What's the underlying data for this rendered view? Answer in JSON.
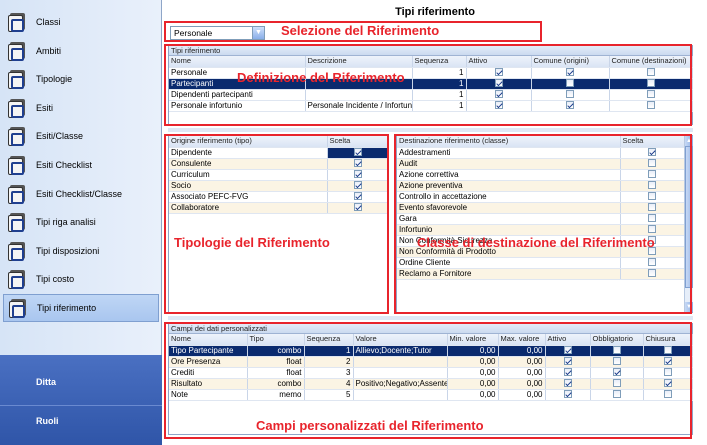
{
  "sidebar": {
    "items": [
      {
        "label": "Classi",
        "icon": "folder-icon"
      },
      {
        "label": "Ambiti",
        "icon": "folder-icon"
      },
      {
        "label": "Tipologie",
        "icon": "folder-icon"
      },
      {
        "label": "Esiti",
        "icon": "folder-icon"
      },
      {
        "label": "Esiti/Classe",
        "icon": "folder-icon"
      },
      {
        "label": "Esiti Checklist",
        "icon": "folder-icon"
      },
      {
        "label": "Esiti Checklist/Classe",
        "icon": "folder-icon"
      },
      {
        "label": "Tipi riga analisi",
        "icon": "folder-icon"
      },
      {
        "label": "Tipi disposizioni",
        "icon": "folder-icon"
      },
      {
        "label": "Tipi costo",
        "icon": "folder-icon"
      },
      {
        "label": "Tipi riferimento",
        "icon": "folder-gear-icon",
        "active": true
      }
    ],
    "bottom": [
      {
        "label": "Ditta"
      },
      {
        "label": "Ruoli"
      }
    ]
  },
  "main": {
    "title": "Tipi riferimento",
    "combo_value": "Personale"
  },
  "annotations": {
    "selezione": "Selezione del Riferimento",
    "definizione": "Definizione del Riferimento",
    "tipologie": "Tipologie del Riferimento",
    "classe": "Classe di destinazione del Riferimento",
    "campi": "Campi personalizzati del Riferimento"
  },
  "ref_table": {
    "title": "Tipi riferimento",
    "headers": [
      "Nome",
      "Descrizione",
      "Sequenza",
      "Attivo",
      "Comune (origini)",
      "Comune (destinazioni)"
    ],
    "rows": [
      {
        "nome": "Personale",
        "descrizione": "",
        "sequenza": "1",
        "attivo": true,
        "origini": true,
        "destinazioni": false
      },
      {
        "nome": "Partecipanti",
        "descrizione": "",
        "sequenza": "1",
        "attivo": true,
        "origini": false,
        "destinazioni": false
      },
      {
        "nome": "Dipendenti partecipanti",
        "descrizione": "",
        "sequenza": "1",
        "attivo": true,
        "origini": false,
        "destinazioni": false
      },
      {
        "nome": "Personale infortunio",
        "descrizione": "Personale Incidente / Infortun",
        "sequenza": "1",
        "attivo": true,
        "origini": true,
        "destinazioni": false
      }
    ]
  },
  "origin_table": {
    "headers": [
      "Origine riferimento (tipo)",
      "Scelta"
    ],
    "rows": [
      {
        "nome": "Dipendente",
        "scelta": true
      },
      {
        "nome": "Consulente",
        "scelta": true
      },
      {
        "nome": "Curriculum",
        "scelta": true
      },
      {
        "nome": "Socio",
        "scelta": true
      },
      {
        "nome": "Associato PEFC-FVG",
        "scelta": true
      },
      {
        "nome": "Collaboratore",
        "scelta": true
      }
    ]
  },
  "dest_table": {
    "headers": [
      "Destinazione riferimento (classe)",
      "Scelta"
    ],
    "rows": [
      {
        "nome": "Addestramenti",
        "scelta": true
      },
      {
        "nome": "Audit",
        "scelta": false
      },
      {
        "nome": "Azione correttiva",
        "scelta": false
      },
      {
        "nome": "Azione preventiva",
        "scelta": false
      },
      {
        "nome": "Controllo in accettazione",
        "scelta": false
      },
      {
        "nome": "Evento sfavorevole",
        "scelta": false
      },
      {
        "nome": "Gara",
        "scelta": false
      },
      {
        "nome": "Infortunio",
        "scelta": false
      },
      {
        "nome": "Non Conformità Sicurezza",
        "scelta": false
      },
      {
        "nome": "Non Conformità di Prodotto",
        "scelta": false
      },
      {
        "nome": "Ordine Cliente",
        "scelta": false
      },
      {
        "nome": "Reclamo a Fornitore",
        "scelta": false
      }
    ]
  },
  "fields_table": {
    "title": "Campi dei dati personalizzati",
    "headers": [
      "Nome",
      "Tipo",
      "Sequenza",
      "Valore",
      "Min. valore",
      "Max. valore",
      "Attivo",
      "Obbligatorio",
      "Chiusura"
    ],
    "rows": [
      {
        "nome": "Tipo Partecipante",
        "tipo": "combo",
        "seq": "1",
        "valore": "Allievo;Docente;Tutor",
        "min": "0,00",
        "max": "0,00",
        "attivo": true,
        "obbl": false,
        "chius": false
      },
      {
        "nome": "Ore Presenza",
        "tipo": "float",
        "seq": "2",
        "valore": "",
        "min": "0,00",
        "max": "0,00",
        "attivo": true,
        "obbl": false,
        "chius": true
      },
      {
        "nome": "Crediti",
        "tipo": "float",
        "seq": "3",
        "valore": "",
        "min": "0,00",
        "max": "0,00",
        "attivo": true,
        "obbl": true,
        "chius": false
      },
      {
        "nome": "Risultato",
        "tipo": "combo",
        "seq": "4",
        "valore": "Positivo;Negativo;Assente",
        "min": "0,00",
        "max": "0,00",
        "attivo": true,
        "obbl": false,
        "chius": true
      },
      {
        "nome": "Note",
        "tipo": "memo",
        "seq": "5",
        "valore": "",
        "min": "0,00",
        "max": "0,00",
        "attivo": true,
        "obbl": false,
        "chius": false
      }
    ]
  }
}
